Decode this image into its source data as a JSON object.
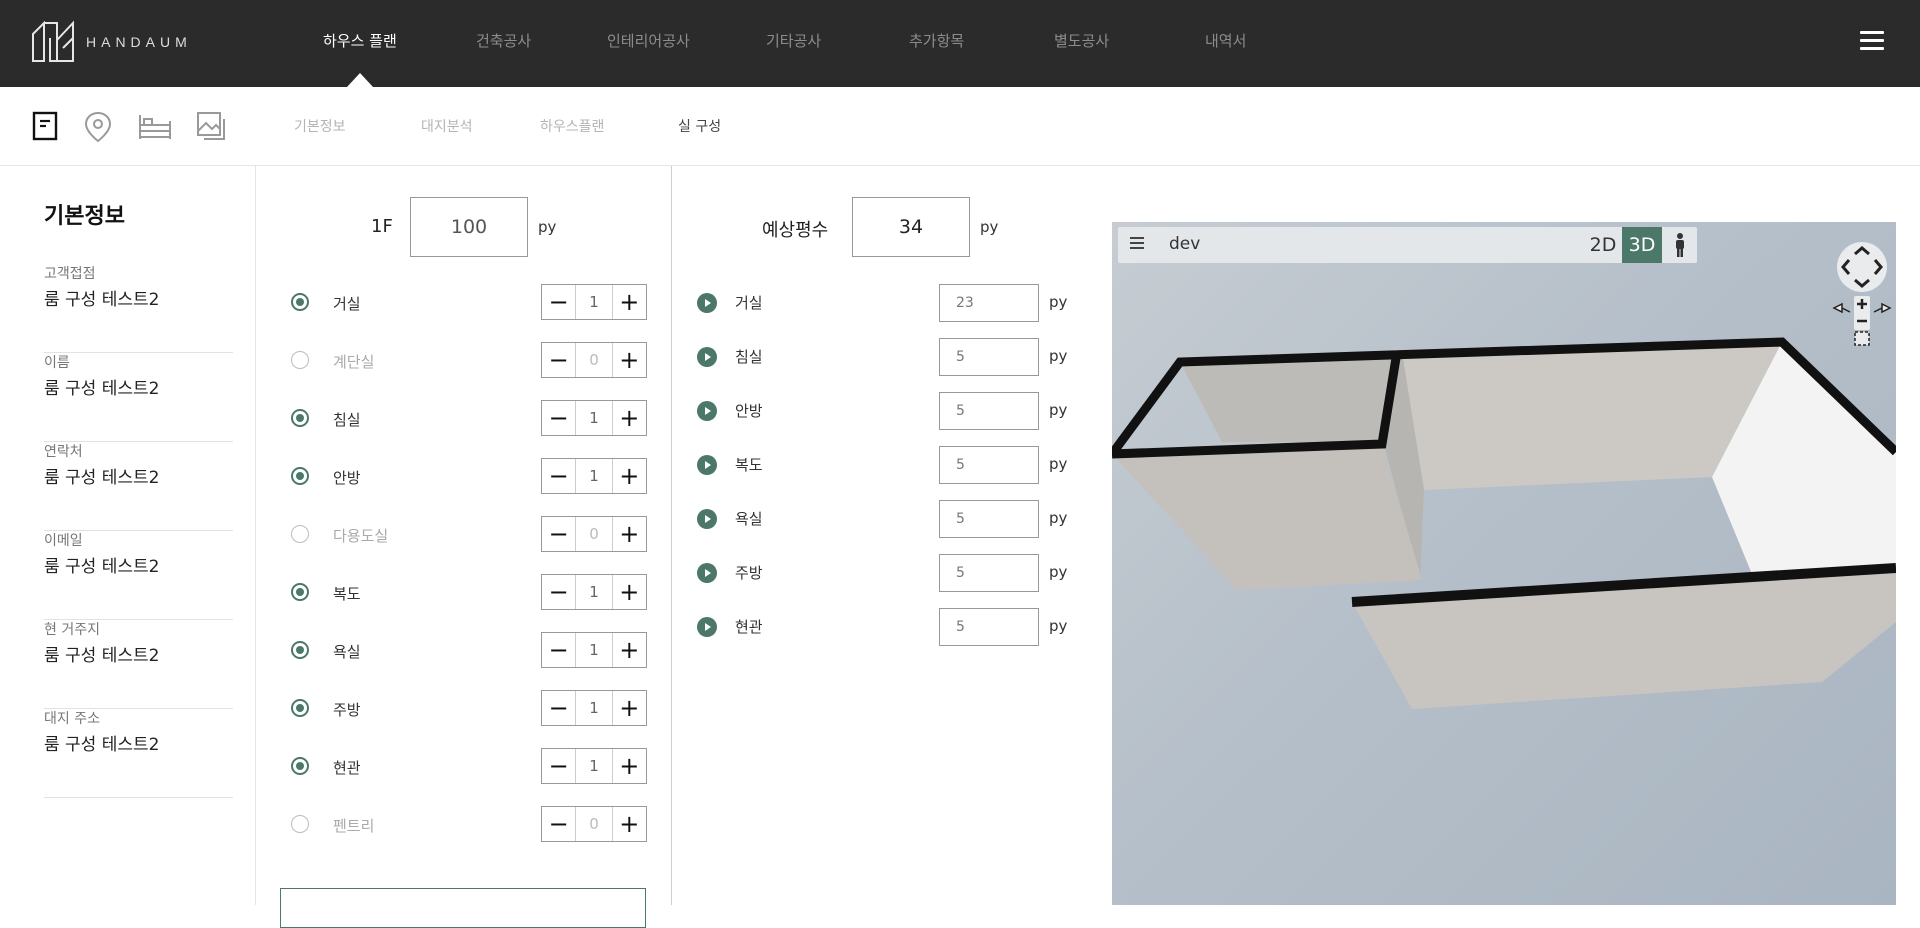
{
  "brand": {
    "name": "HANDAUM"
  },
  "nav": {
    "items": [
      {
        "label": "하우스 플랜"
      },
      {
        "label": "건축공사"
      },
      {
        "label": "인테리어공사"
      },
      {
        "label": "기타공사"
      },
      {
        "label": "추가항목"
      },
      {
        "label": "별도공사"
      },
      {
        "label": "내역서"
      }
    ],
    "active": "하우스 플랜"
  },
  "subnav": {
    "icons": [
      "document-icon",
      "location-pin-icon",
      "bed-icon",
      "image-icon"
    ],
    "items": [
      {
        "label": "기본정보"
      },
      {
        "label": "대지분석"
      },
      {
        "label": "하우스플랜"
      },
      {
        "label": "실 구성"
      }
    ],
    "active": "실 구성"
  },
  "info": {
    "title": "기본정보",
    "fields": [
      {
        "label": "고객접점",
        "value": "룸 구성 테스트2"
      },
      {
        "label": "이름",
        "value": "룸 구성 테스트2"
      },
      {
        "label": "연락처",
        "value": "룸 구성 테스트2"
      },
      {
        "label": "이메일",
        "value": "룸 구성 테스트2"
      },
      {
        "label": "현 거주지",
        "value": "룸 구성 테스트2"
      },
      {
        "label": "대지 주소",
        "value": "룸 구성 테스트2"
      }
    ]
  },
  "rooms": {
    "floor_label": "1F",
    "floor_area": "100",
    "unit": "py",
    "items": [
      {
        "label": "거실",
        "selected": true,
        "count": "1"
      },
      {
        "label": "계단실",
        "selected": false,
        "count": "0"
      },
      {
        "label": "침실",
        "selected": true,
        "count": "1"
      },
      {
        "label": "안방",
        "selected": true,
        "count": "1"
      },
      {
        "label": "다용도실",
        "selected": false,
        "count": "0"
      },
      {
        "label": "복도",
        "selected": true,
        "count": "1"
      },
      {
        "label": "욕실",
        "selected": true,
        "count": "1"
      },
      {
        "label": "주방",
        "selected": true,
        "count": "1"
      },
      {
        "label": "현관",
        "selected": true,
        "count": "1"
      },
      {
        "label": "펜트리",
        "selected": false,
        "count": "0"
      }
    ]
  },
  "areas": {
    "label": "예상평수",
    "total": "34",
    "unit": "py",
    "items": [
      {
        "label": "거실",
        "value": "23"
      },
      {
        "label": "침실",
        "value": "5"
      },
      {
        "label": "안방",
        "value": "5"
      },
      {
        "label": "복도",
        "value": "5"
      },
      {
        "label": "욕실",
        "value": "5"
      },
      {
        "label": "주방",
        "value": "5"
      },
      {
        "label": "현관",
        "value": "5"
      }
    ]
  },
  "viewer": {
    "title": "dev",
    "mode_2d": "2D",
    "mode_3d": "3D",
    "active_mode": "3D"
  },
  "colors": {
    "accent": "#4b7868",
    "topbar": "#2b2b2b"
  }
}
